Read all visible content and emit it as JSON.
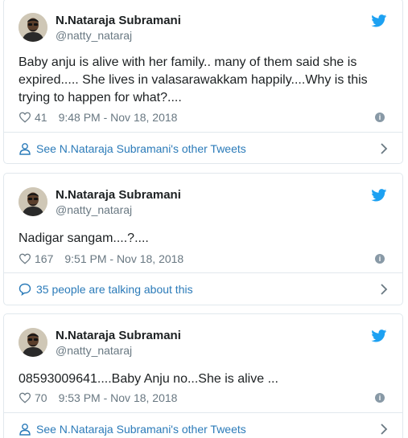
{
  "author": {
    "name": "N.Nataraja Subramani",
    "handle": "@natty_nataraj"
  },
  "tweets": [
    {
      "text": "Baby anju is alive with her family.. many of them said she is expired..... She lives in valasarawakkam happily....Why is this trying to happen for what?....",
      "likes": "41",
      "timestamp": "9:48 PM - Nov 18, 2018",
      "footer_label": "See N.Nataraja Subramani's other Tweets",
      "footer_icon": "person-icon"
    },
    {
      "text": "Nadigar sangam....?....",
      "likes": "167",
      "timestamp": "9:51 PM - Nov 18, 2018",
      "footer_label": "35 people are talking about this",
      "footer_icon": "speech-bubble-icon"
    },
    {
      "text": "08593009641....Baby Anju no...She is alive ...",
      "likes": "70",
      "timestamp": "9:53 PM - Nov 18, 2018",
      "footer_label": "See N.Nataraja Subramani's other Tweets",
      "footer_icon": "person-icon"
    }
  ],
  "colors": {
    "twitter_blue": "#1da1f2",
    "link_blue": "#2b7bb9",
    "muted": "#697882",
    "border": "#e1e8ed"
  }
}
